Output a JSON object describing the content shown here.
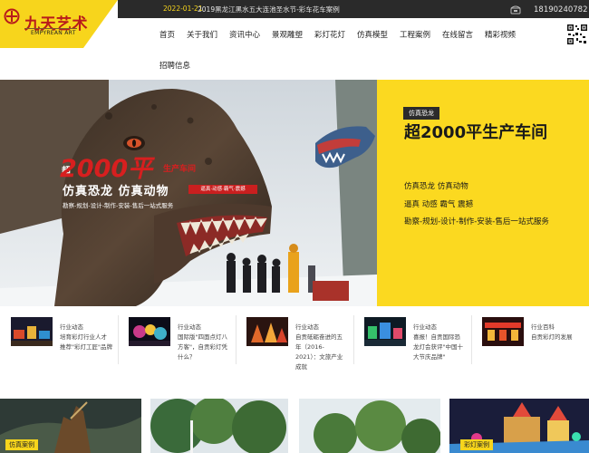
{
  "brand": {
    "name_cn": "九天艺术",
    "name_en": "EMPYREAN ART",
    "accent": "#f7d51c",
    "brand_red": "#b81b1b"
  },
  "topbar": {
    "date": "2022-01-21",
    "news": "2019黑龙江黑水五大连池圣水节-彩车花车案例",
    "phone": "18190240782",
    "phone_icon": "phone-icon"
  },
  "nav": {
    "items": [
      {
        "label": "首页"
      },
      {
        "label": "关于我们"
      },
      {
        "label": "资讯中心"
      },
      {
        "label": "景观雕塑"
      },
      {
        "label": "彩灯花灯"
      },
      {
        "label": "仿真模型"
      },
      {
        "label": "工程案例"
      },
      {
        "label": "在线留言"
      },
      {
        "label": "精彩视频"
      },
      {
        "label": "招聘信息"
      }
    ]
  },
  "banner": {
    "tag": "仿真恐龙",
    "title": "超2000平生产车间",
    "line1": "仿真恐龙 仿真动物",
    "line2": "逼真 动感 霸气 震撼",
    "line3": "勘察-规划-设计-制作-安装-售后一站式服务",
    "photo": {
      "big": "2000平",
      "chao": "超",
      "sheng": "生产车间",
      "fz": "仿真恐龙 仿真动物",
      "red_label": "逼真·动感·霸气·震撼",
      "small": "勘察-规划-设计-制作-安装-售后一站式服务"
    }
  },
  "news": [
    {
      "cat": "行业动态",
      "title": "培育彩灯行业人才推荐\"彩灯工匠\"品牌"
    },
    {
      "cat": "行业动态",
      "title": "国际版\"四面点灯八方客\"，自贡彩灯凭什么？"
    },
    {
      "cat": "行业动态",
      "title": "自贡砥砺奋进的五年（2016-2021）：文旅产业成就"
    },
    {
      "cat": "行业动态",
      "title": "喜报！自贡国际恐龙灯会获评\"中国十大节庆品牌\""
    },
    {
      "cat": "行业百科",
      "title": "自贡彩灯的发展"
    }
  ],
  "gallery": [
    {
      "tag": "仿真案例"
    },
    {
      "tag": ""
    },
    {
      "tag": ""
    },
    {
      "tag": "彩灯案例"
    }
  ]
}
